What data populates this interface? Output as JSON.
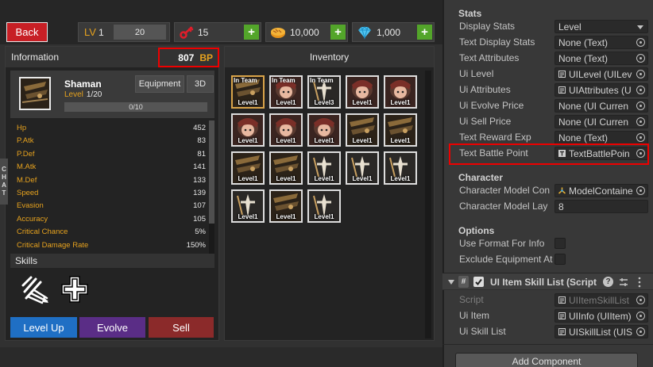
{
  "topbar": {
    "back_label": "Back",
    "level_label": "LV",
    "level_value": "1",
    "level_input": "20",
    "currency1": "15",
    "currency2": "10,000",
    "currency3": "1,000",
    "plus": "+"
  },
  "info": {
    "header": "Information",
    "bp_value": "807",
    "bp_label": "BP",
    "char_name": "Shaman",
    "level_key": "Level",
    "level_val": "1/20",
    "xp_text": "0/10",
    "equipment_label": "Equipment",
    "three_d_label": "3D",
    "stats": [
      {
        "k": "Hp",
        "v": "452"
      },
      {
        "k": "P.Atk",
        "v": "83"
      },
      {
        "k": "P.Def",
        "v": "81"
      },
      {
        "k": "M.Atk",
        "v": "141"
      },
      {
        "k": "M.Def",
        "v": "133"
      },
      {
        "k": "Speed",
        "v": "139"
      },
      {
        "k": "Evasion",
        "v": "107"
      },
      {
        "k": "Accuracy",
        "v": "105"
      },
      {
        "k": "Critical Chance",
        "v": "5%"
      },
      {
        "k": "Critical Damage Rate",
        "v": "150%"
      }
    ],
    "skills_header": "Skills",
    "level_up_label": "Level Up",
    "evolve_label": "Evolve",
    "sell_label": "Sell",
    "chat_letters": [
      "C",
      "H",
      "A",
      "T"
    ]
  },
  "inventory": {
    "header": "Inventory",
    "team_label": "In Team",
    "items": [
      {
        "level": "Level1",
        "team": true,
        "type": "shaman",
        "selected": true
      },
      {
        "level": "Level1",
        "team": true,
        "type": "girl"
      },
      {
        "level": "Level3",
        "team": true,
        "type": "knight"
      },
      {
        "level": "Level1",
        "team": false,
        "type": "girl"
      },
      {
        "level": "Level1",
        "team": false,
        "type": "girl"
      },
      {
        "level": "Level1",
        "team": false,
        "type": "girl"
      },
      {
        "level": "Level1",
        "team": false,
        "type": "girl"
      },
      {
        "level": "Level1",
        "team": false,
        "type": "girl"
      },
      {
        "level": "Level1",
        "team": false,
        "type": "shaman"
      },
      {
        "level": "Level1",
        "team": false,
        "type": "shaman"
      },
      {
        "level": "Level1",
        "team": false,
        "type": "shaman"
      },
      {
        "level": "Level1",
        "team": false,
        "type": "shaman"
      },
      {
        "level": "Level1",
        "team": false,
        "type": "knight"
      },
      {
        "level": "Level1",
        "team": false,
        "type": "knight"
      },
      {
        "level": "Level1",
        "team": false,
        "type": "knight"
      },
      {
        "level": "Level1",
        "team": false,
        "type": "knight"
      },
      {
        "level": "Level1",
        "team": false,
        "type": "shaman"
      },
      {
        "level": "Level1",
        "team": false,
        "type": "knight"
      }
    ]
  },
  "inspector": {
    "stats_section": "Stats",
    "rows": [
      {
        "label": "Display Stats",
        "value": "Level",
        "kind": "dropdown"
      },
      {
        "label": "Text Display Stats",
        "value": "None (Text)",
        "kind": "object"
      },
      {
        "label": "Text Attributes",
        "value": "None (Text)",
        "kind": "object"
      },
      {
        "label": "Ui Level",
        "value": "UILevel (UILev",
        "kind": "script"
      },
      {
        "label": "Ui Attributes",
        "value": "UIAttributes (U",
        "kind": "script"
      },
      {
        "label": "Ui Evolve Price",
        "value": "None (UI Curren",
        "kind": "object"
      },
      {
        "label": "Ui Sell Price",
        "value": "None (UI Curren",
        "kind": "object"
      },
      {
        "label": "Text Reward Exp",
        "value": "None (Text)",
        "kind": "object"
      },
      {
        "label": "Text Battle Point",
        "value": "TextBattlePoin",
        "kind": "text"
      }
    ],
    "character_section": "Character",
    "char_rows": [
      {
        "label": "Character Model Con",
        "value": "ModelContaine",
        "kind": "transform"
      },
      {
        "label": "Character Model Lay",
        "value": "8",
        "kind": "int"
      }
    ],
    "options_section": "Options",
    "option_rows": [
      {
        "label": "Use Format For Info"
      },
      {
        "label": "Exclude Equipment At"
      }
    ],
    "component_title": "UI Item Skill List (Script",
    "comp_rows": [
      {
        "label": "Script",
        "value": "UIItemSkillList",
        "kind": "script",
        "disabled": true
      },
      {
        "label": "Ui Item",
        "value": "UIInfo (UIItem)",
        "kind": "script"
      },
      {
        "label": "Ui Skill List",
        "value": "UISkillList (UIS",
        "kind": "script"
      }
    ],
    "add_component_label": "Add Component"
  },
  "colors": {
    "back": "#c71f25",
    "bp_label": "#e6a21e",
    "stat_key": "#e6a21e",
    "level_up": "#1f6fc4",
    "evolve": "#5a2d86",
    "sell": "#8b2a2a",
    "plus_button": "#53a52a",
    "highlight": "#ee0000"
  }
}
